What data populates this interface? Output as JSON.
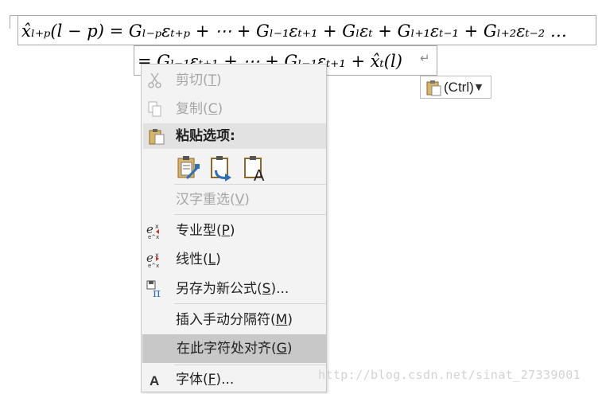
{
  "equation": {
    "line1": "x̂ₗ₊ₚ(l − p) = Gₗ₋ₚεₜ₊ₚ + ⋯ + Gₗ₋₁εₜ₊₁ + Gₗεₜ + Gₗ₊₁εₜ₋₁ + Gₗ₊₂εₜ₋₂ …",
    "line2": "= Gₗ₋₁εₜ₊₁ + ⋯ + Gₗ₋₁εₜ₊₁ + x̂ₜ(l)",
    "paragraph_mark": "↵"
  },
  "paste_tag": {
    "label": "(Ctrl)",
    "icon": "clipboard-icon"
  },
  "context_menu": {
    "cut": {
      "label": "剪切",
      "accel": "T",
      "icon": "scissors-icon",
      "enabled": false
    },
    "copy": {
      "label": "复制",
      "accel": "C",
      "icon": "copy-icon",
      "enabled": false
    },
    "paste_options": {
      "label": "粘贴选项:",
      "icon": "clipboard-icon",
      "options": [
        "keep-source-formatting-icon",
        "merge-formatting-icon",
        "keep-text-only-icon"
      ]
    },
    "hanzi_reselect": {
      "label": "汉字重选",
      "accel": "V",
      "enabled": false
    },
    "professional": {
      "label": "专业型",
      "accel": "P",
      "icon": "professional-equation-icon"
    },
    "linear": {
      "label": "线性",
      "accel": "L",
      "icon": "linear-equation-icon"
    },
    "save_as_new": {
      "label": "另存为新公式",
      "accel": "S",
      "suffix": "...",
      "icon": "save-pi-icon"
    },
    "insert_break": {
      "label": "插入手动分隔符",
      "accel": "M"
    },
    "align_here": {
      "label": "在此字符处对齐",
      "accel": "G"
    },
    "font": {
      "label": "字体",
      "accel": "F",
      "suffix": "...",
      "icon": "font-a-icon"
    }
  },
  "watermark": "http://blog.csdn.net/sinat_27339001"
}
